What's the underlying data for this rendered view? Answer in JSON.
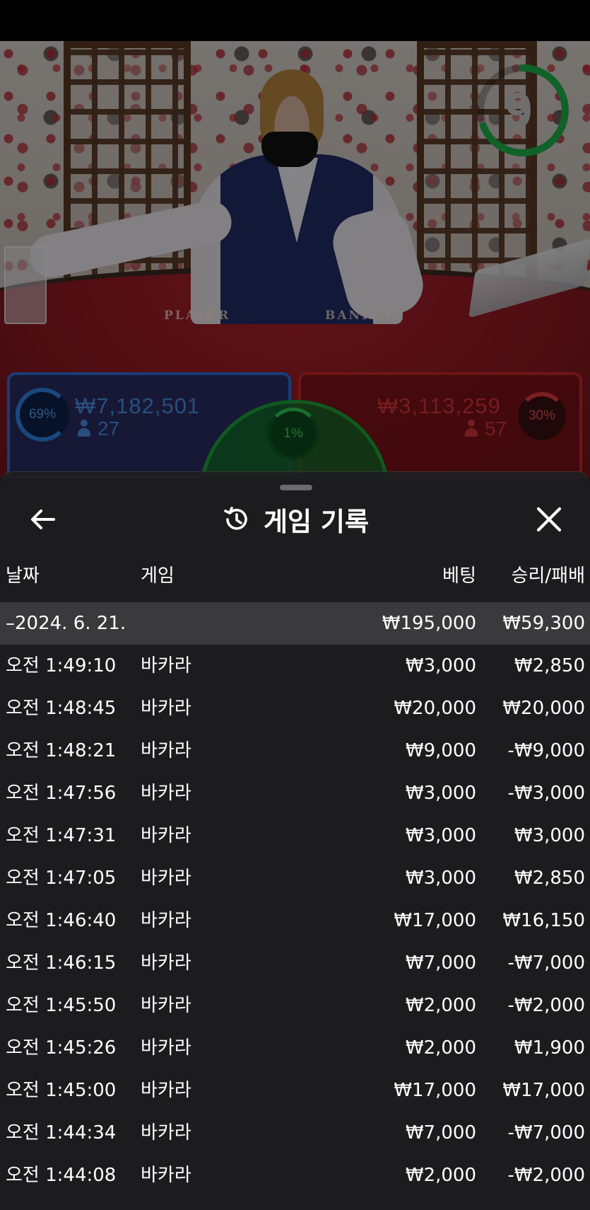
{
  "timer": {
    "value": "9",
    "color": "#1fb34a"
  },
  "table_felt": {
    "player_label": "PLAYER",
    "banker_label": "BANKER"
  },
  "bets": {
    "player": {
      "percent": "69%",
      "amount": "₩7,182,501",
      "count": "27",
      "color": "#2f84e6"
    },
    "banker": {
      "percent": "30%",
      "amount": "₩3,113,259",
      "count": "57",
      "color": "#e03a3a"
    },
    "tie": {
      "percent": "1%",
      "color": "#2ecc55"
    }
  },
  "sheet": {
    "title": "게임 기록",
    "icons": {
      "back": "arrow-left-icon",
      "history": "history-icon",
      "close": "close-icon"
    },
    "columns": {
      "date": "날짜",
      "game": "게임",
      "bet": "베팅",
      "result": "승리/패배"
    },
    "day_summary": {
      "date": "–2024. 6. 21.",
      "bet": "₩195,000",
      "result": "₩59,300"
    },
    "rows": [
      {
        "time": "오전 1:49:10",
        "game": "바카라",
        "bet": "₩3,000",
        "result": "₩2,850"
      },
      {
        "time": "오전 1:48:45",
        "game": "바카라",
        "bet": "₩20,000",
        "result": "₩20,000"
      },
      {
        "time": "오전 1:48:21",
        "game": "바카라",
        "bet": "₩9,000",
        "result": "-₩9,000"
      },
      {
        "time": "오전 1:47:56",
        "game": "바카라",
        "bet": "₩3,000",
        "result": "-₩3,000"
      },
      {
        "time": "오전 1:47:31",
        "game": "바카라",
        "bet": "₩3,000",
        "result": "₩3,000"
      },
      {
        "time": "오전 1:47:05",
        "game": "바카라",
        "bet": "₩3,000",
        "result": "₩2,850"
      },
      {
        "time": "오전 1:46:40",
        "game": "바카라",
        "bet": "₩17,000",
        "result": "₩16,150"
      },
      {
        "time": "오전 1:46:15",
        "game": "바카라",
        "bet": "₩7,000",
        "result": "-₩7,000"
      },
      {
        "time": "오전 1:45:50",
        "game": "바카라",
        "bet": "₩2,000",
        "result": "-₩2,000"
      },
      {
        "time": "오전 1:45:26",
        "game": "바카라",
        "bet": "₩2,000",
        "result": "₩1,900"
      },
      {
        "time": "오전 1:45:00",
        "game": "바카라",
        "bet": "₩17,000",
        "result": "₩17,000"
      },
      {
        "time": "오전 1:44:34",
        "game": "바카라",
        "bet": "₩7,000",
        "result": "-₩7,000"
      },
      {
        "time": "오전 1:44:08",
        "game": "바카라",
        "bet": "₩2,000",
        "result": "-₩2,000"
      }
    ]
  }
}
